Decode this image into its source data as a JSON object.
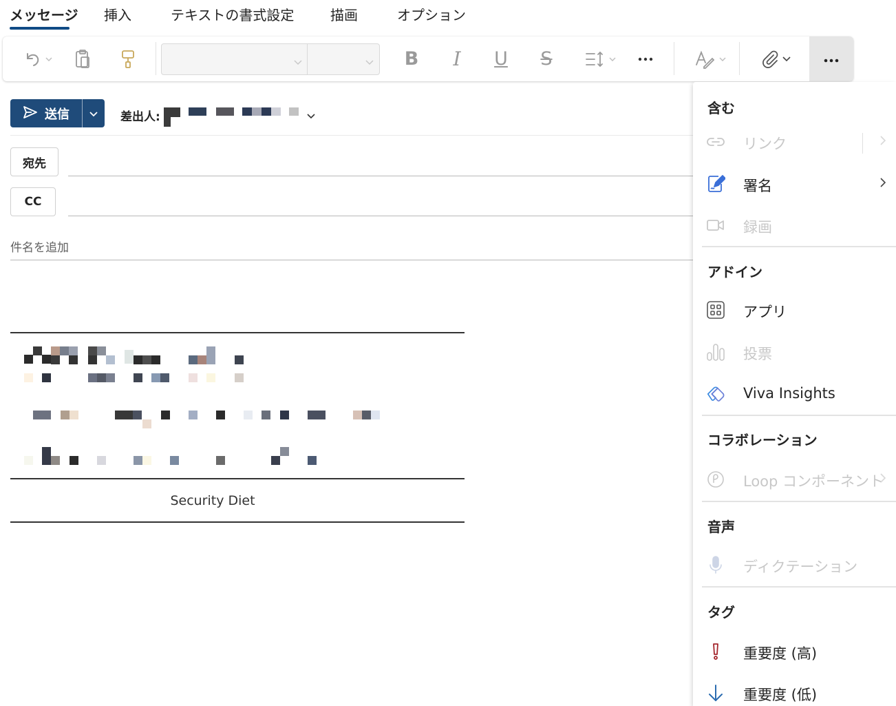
{
  "tabs": [
    "メッセージ",
    "挿入",
    "テキストの書式設定",
    "描画",
    "オプション"
  ],
  "ribbon": {
    "icons": [
      "undo-icon",
      "paste-icon",
      "format-painter-icon",
      "bold-icon",
      "italic-icon",
      "underline-icon",
      "strikethrough-icon",
      "line-spacing-icon",
      "more-icon",
      "styles-icon",
      "attach-icon",
      "more-active-icon"
    ],
    "bold": "B",
    "italic": "I",
    "underline": "U",
    "strike": "S"
  },
  "compose": {
    "send_label": "送信",
    "from_label": "差出人:",
    "to_label": "宛先",
    "cc_label": "CC",
    "subject_placeholder": "件名を追加"
  },
  "signature": {
    "name": "Security Diet"
  },
  "menu": {
    "include_header": "含む",
    "link": "リンク",
    "signature": "署名",
    "record": "録画",
    "addins_header": "アドイン",
    "apps": "アプリ",
    "poll": "投票",
    "viva": "Viva Insights",
    "collab_header": "コラボレーション",
    "loop": "Loop コンポーネント",
    "voice_header": "音声",
    "dictation": "ディクテーション",
    "tags_header": "タグ",
    "high": "重要度 (高)",
    "low": "重要度 (低)"
  },
  "colors": {
    "accent": "#1f4b7a",
    "tab_underline": "#0f4a85",
    "high_importance": "#a4262c",
    "low_importance": "#2b6cb0",
    "icon_blue": "#3a6fd8"
  }
}
